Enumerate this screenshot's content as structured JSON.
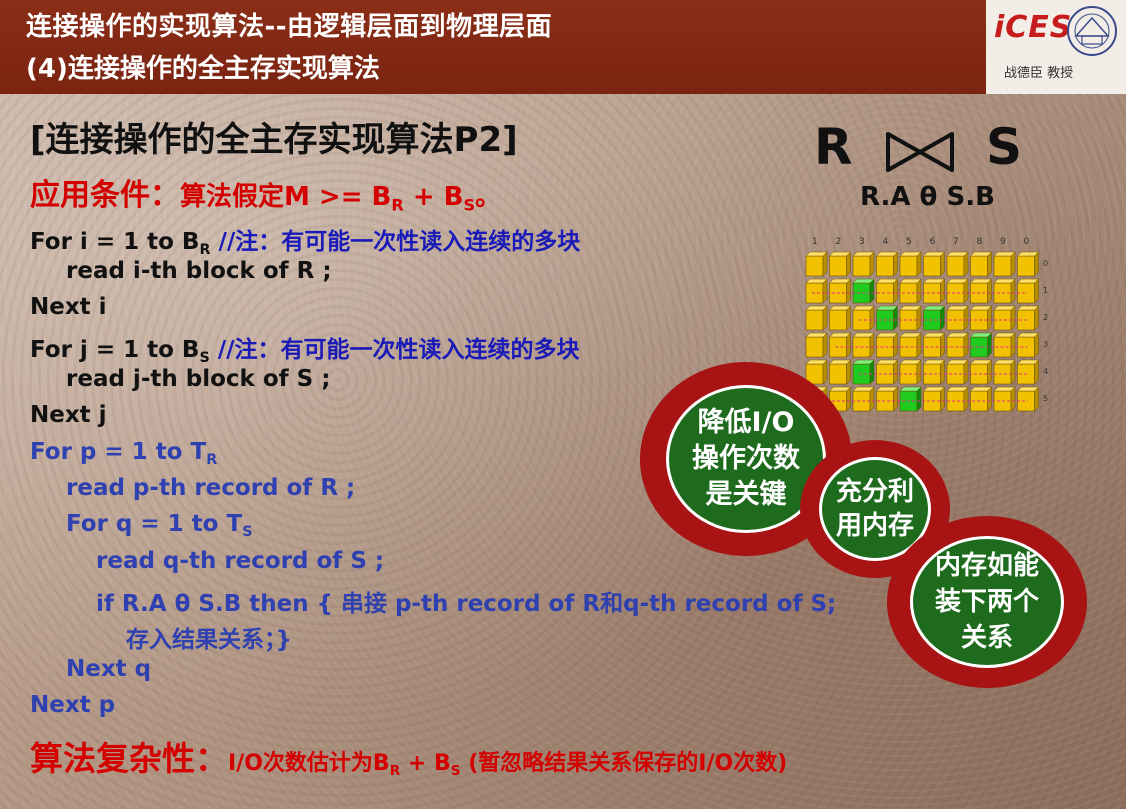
{
  "header": {
    "line1": "连接操作的实现算法--由逻辑层面到物理层面",
    "line2": "(4)连接操作的全主存实现算法",
    "logo_text": "iCES",
    "logo_author": "战德臣 教授"
  },
  "title": "[连接操作的全主存实现算法P2]",
  "condition": {
    "label": "应用条件：",
    "text_a": "算法假定M >= B",
    "sub_a": "R",
    "text_b": " + B",
    "sub_b": "S",
    "text_c": "。"
  },
  "code": [
    {
      "pre": "For  i = 1 to B",
      "sub": "R",
      "note": " //注：有可能一次性读入连续的多块"
    },
    {
      "text": "read i-th block of R ;"
    },
    {
      "text": "Next i"
    },
    {
      "pre": "For j = 1 to B",
      "sub": "S",
      "note": " //注：有可能一次性读入连续的多块"
    },
    {
      "text": "read j-th block of S ;"
    },
    {
      "text": "Next j"
    },
    {
      "pre": "For  p = 1 to T",
      "sub": "R"
    },
    {
      "text": "read p-th record of R ;"
    },
    {
      "pre": "For q = 1 to T",
      "sub": "S"
    },
    {
      "text": "read q-th record of S ;"
    },
    {
      "text": "if R.A θ S.B then { 串接 p-th record of R和q-th record of S;"
    },
    {
      "text": "存入结果关系；}"
    },
    {
      "text": "Next q"
    },
    {
      "text": "Next p"
    }
  ],
  "complexity": {
    "label": "算法复杂性：",
    "text_a": "I/O次数估计为B",
    "sub_a": "R",
    "text_b": " + B",
    "sub_b": "S",
    "text_c": " (暂忽略结果关系保存的I/O次数)"
  },
  "join": {
    "left": "R",
    "right": "S",
    "label": "R.A θ S.B"
  },
  "grid": {
    "columns": [
      "1",
      "2",
      "3",
      "4",
      "5",
      "6",
      "7",
      "8",
      "9",
      "0"
    ],
    "rows": [
      "0",
      "1",
      "2",
      "3",
      "4",
      "5"
    ]
  },
  "badges": [
    {
      "line1": "降低I/O",
      "line2": "操作次数",
      "line3": "是关键"
    },
    {
      "line1": "充分利",
      "line2": "用内存"
    },
    {
      "line1": "内存如能",
      "line2": "装下两个",
      "line3": "关系"
    }
  ],
  "colors": {
    "header_bg": "#7a2410",
    "red_text": "#d40000",
    "blue_text": "#1a1ab8",
    "badge_ring": "#a81414",
    "badge_fill": "#1e6b1e",
    "cell_yellow": "#f2c200",
    "cell_green": "#1ecb1e"
  }
}
